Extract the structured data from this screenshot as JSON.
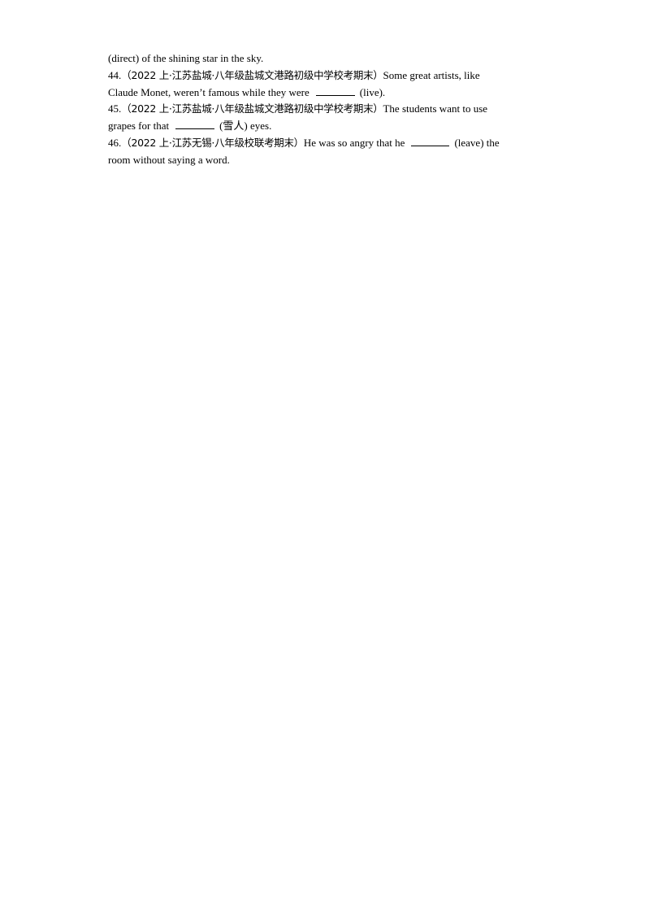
{
  "document": {
    "continuation": "(direct) of the shining star in the sky.",
    "questions": [
      {
        "number": "44.",
        "source": "（2022 上·江苏盐城·八年级盐城文港路初级中学校考期末）",
        "text_before_line1": "Some great artists, like",
        "text_before_line2": "Claude Monet, weren’t famous while they were",
        "blank": "________",
        "hint": "(live)."
      },
      {
        "number": "45.",
        "source": "（2022 上·江苏盐城·八年级盐城文港路初级中学校考期末）",
        "text_before_line1": "The students want to use",
        "text_before_line2": "grapes for that",
        "blank": "________",
        "hint": "(雪人) eyes."
      },
      {
        "number": "46.",
        "source": "（2022 上·江苏无锡·八年级校联考期末）",
        "text_before_line1": "He was so angry that he",
        "blank": "________",
        "hint_line1": "(leave) the",
        "text_line2": "room without saying a word."
      }
    ]
  }
}
